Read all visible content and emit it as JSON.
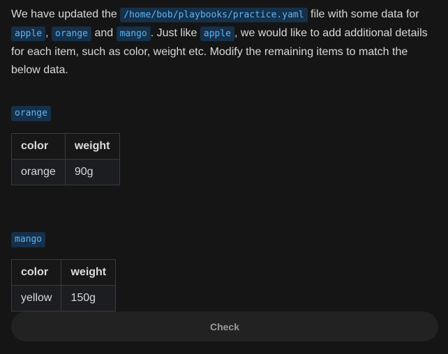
{
  "intro": {
    "t1": "We have updated the ",
    "path": "/home/bob/playbooks/practice.yaml",
    "t2": " file with some data for ",
    "item_apple": "apple",
    "t3": ", ",
    "item_orange": "orange",
    "t4": " and ",
    "item_mango": "mango",
    "t5": ". Just like ",
    "item_apple_2": "apple",
    "t6": ", we would like to add additional details for each item, such as color, weight etc. Modify the remaining items to match the below data."
  },
  "sections": [
    {
      "name": "orange",
      "headers": [
        "color",
        "weight"
      ],
      "row": [
        "orange",
        "90g"
      ]
    },
    {
      "name": "mango",
      "headers": [
        "color",
        "weight"
      ],
      "row": [
        "yellow",
        "150g"
      ]
    }
  ],
  "check_button": {
    "label": "Check"
  }
}
